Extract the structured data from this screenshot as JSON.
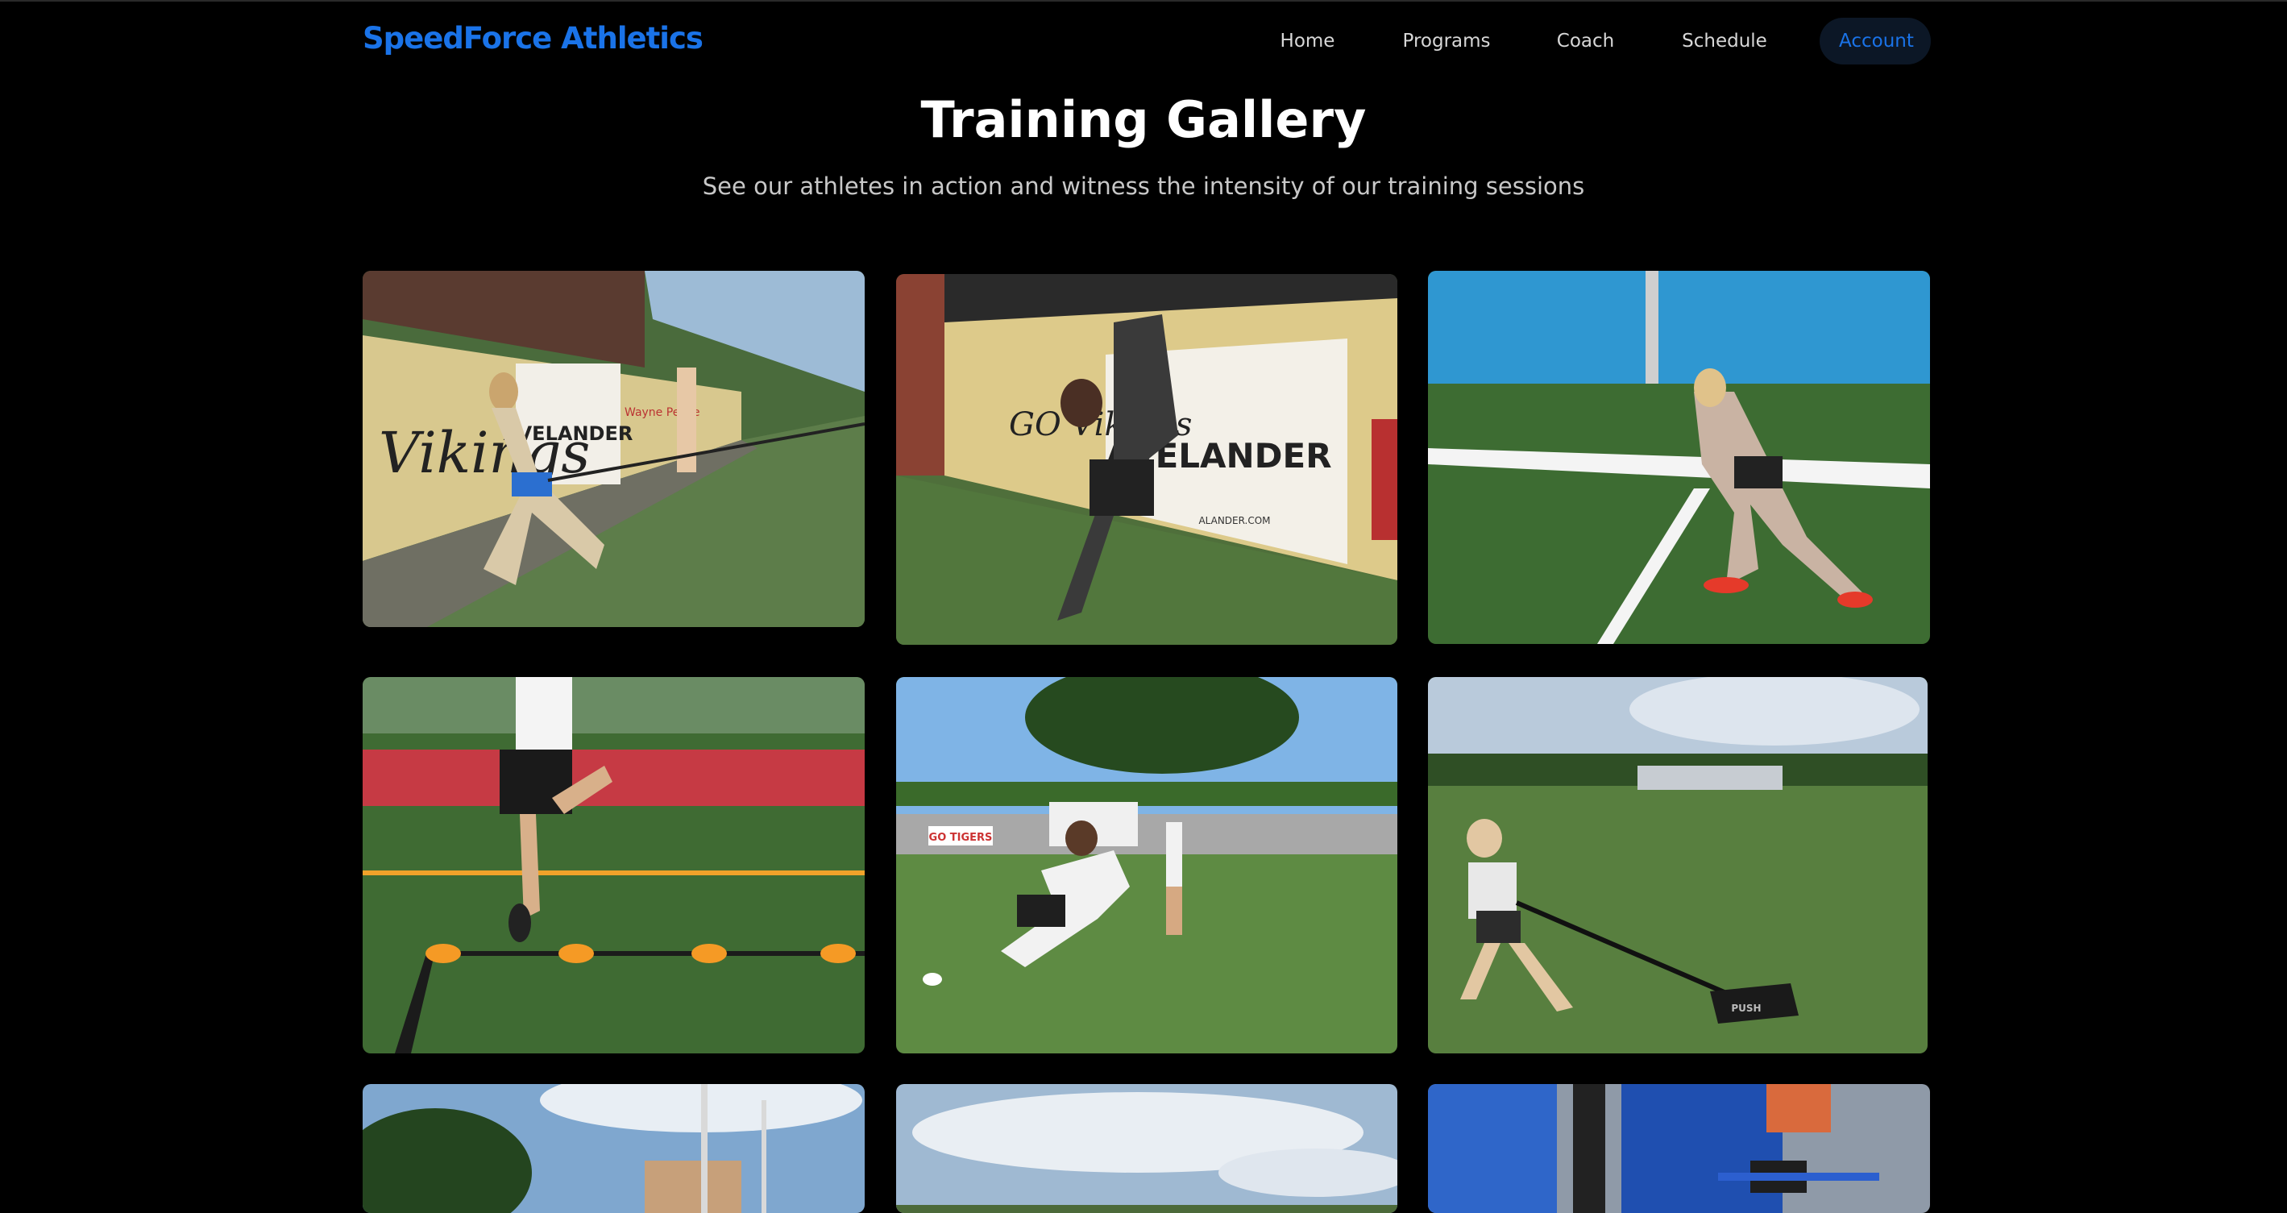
{
  "header": {
    "brand": "SpeedForce Athletics",
    "nav": [
      "Home",
      "Programs",
      "Coach",
      "Schedule",
      "Account"
    ],
    "active_nav": "Account"
  },
  "main": {
    "title": "Training Gallery",
    "subtitle": "See our athletes in action and witness the intensity of our training sessions"
  },
  "gallery": {
    "photos": [
      {
        "sign_1": "Vikings",
        "sign_2": "AVELANDER",
        "sign_3": "Wayne Pence"
      },
      {
        "sign_1": "GO Vikings",
        "sign_2": "AVELANDER",
        "sign_3": "ALANDER.COM"
      },
      {},
      {},
      {
        "sign_1": "GO TIGERS"
      },
      {
        "sign_1": "PUSH"
      },
      {},
      {},
      {}
    ]
  },
  "colors": {
    "brand": "#1a73e8",
    "background": "#000000",
    "active_nav_bg": "#0c1726"
  }
}
